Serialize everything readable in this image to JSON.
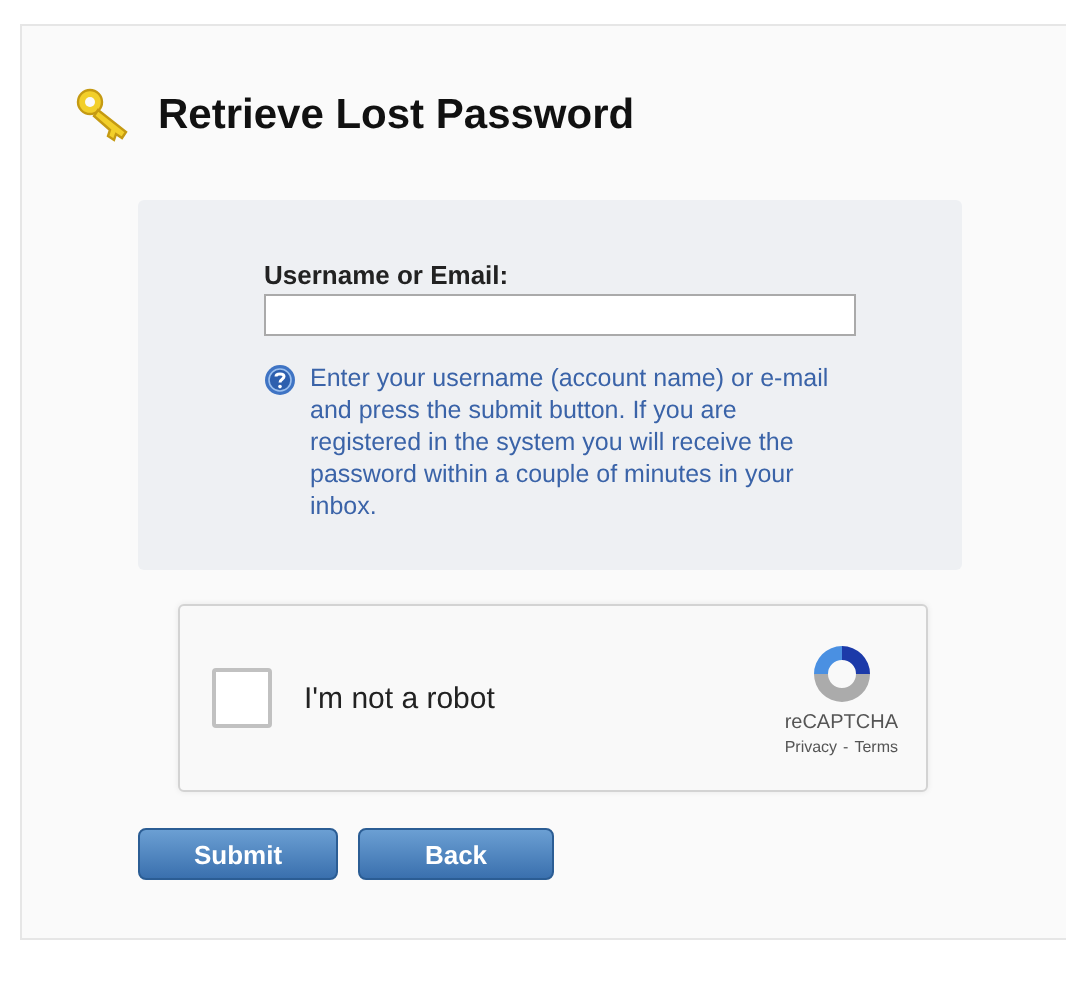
{
  "title": "Retrieve Lost Password",
  "form": {
    "label": "Username or Email:",
    "help": "Enter your username (account name) or e-mail and press the submit button. If you are registered in the system you will receive the password within a couple of minutes in your inbox."
  },
  "captcha": {
    "label": "I'm not a robot",
    "checked": false,
    "brand": "reCAPTCHA",
    "links": [
      "Privacy",
      "Terms"
    ],
    "separator": "-"
  },
  "buttons": [
    "Submit",
    "Back"
  ]
}
